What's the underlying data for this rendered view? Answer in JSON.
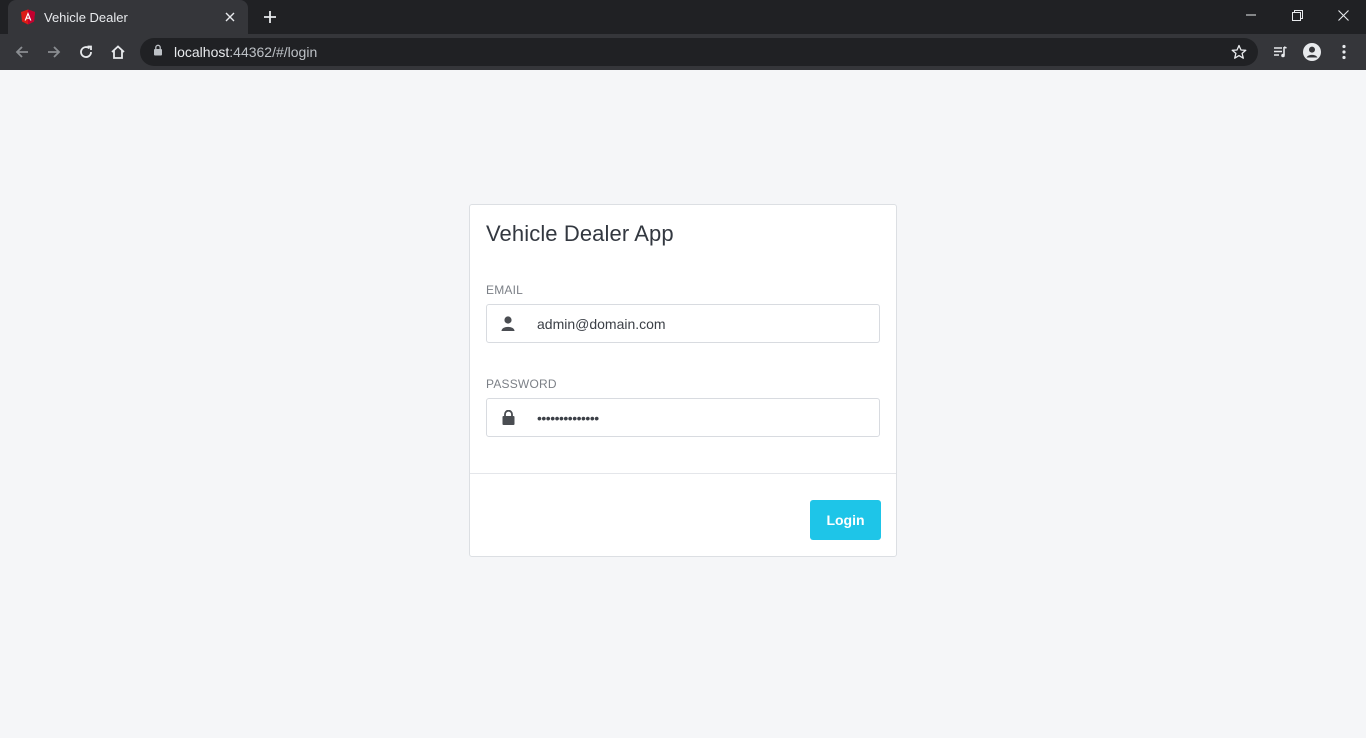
{
  "browser": {
    "tab_title": "Vehicle Dealer",
    "url_host": "localhost",
    "url_rest": ":44362/#/login",
    "tab_favicon": "angular-icon"
  },
  "login": {
    "title": "Vehicle Dealer App",
    "email_label": "EMAIL",
    "email_value": "admin@domain.com",
    "password_label": "PASSWORD",
    "password_value": "••••••••••••••",
    "login_button": "Login"
  },
  "colors": {
    "accent": "#1ec5e8",
    "page_bg": "#f5f6f8",
    "chrome_dark": "#202124",
    "chrome_toolbar": "#35363a"
  }
}
